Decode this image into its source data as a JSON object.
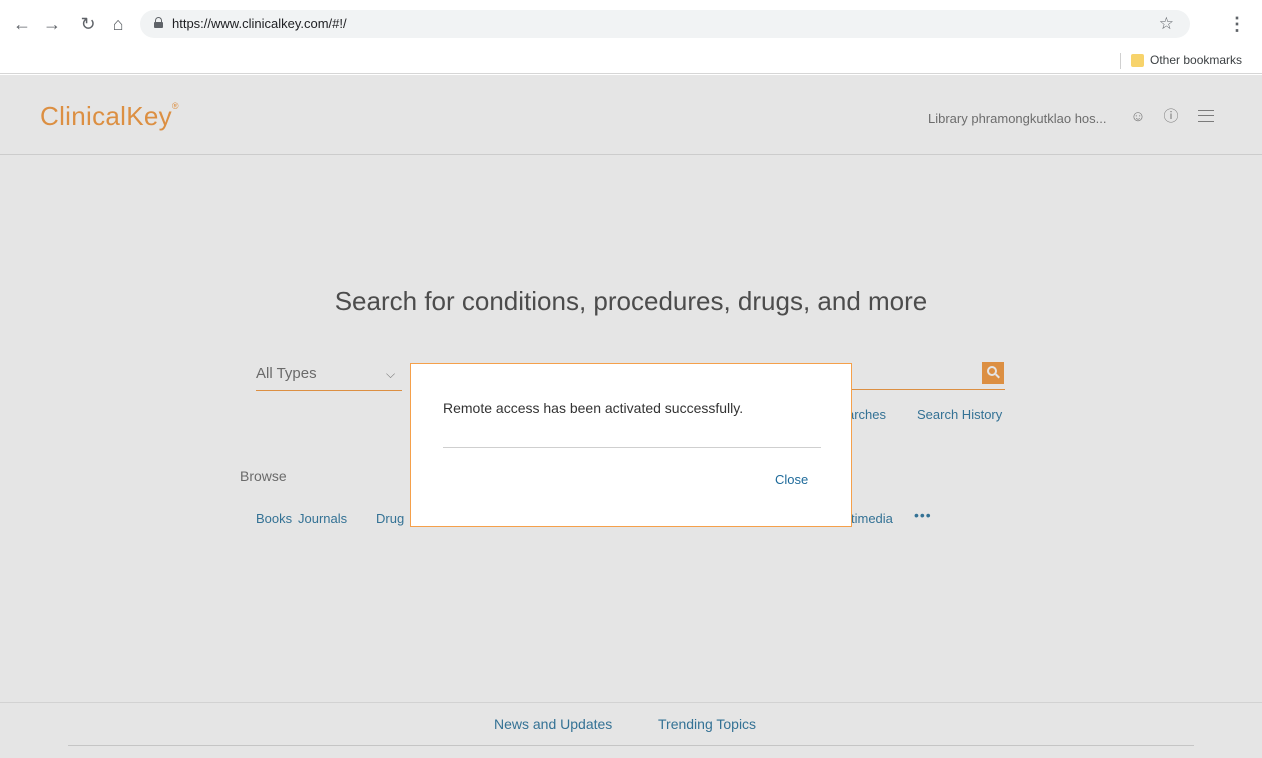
{
  "browser": {
    "url": "https://www.clinicalkey.com/#!/",
    "bookmarks_label": "Other bookmarks"
  },
  "header": {
    "logo": "ClinicalKey",
    "logo_mark": "®",
    "user_name": "Library phramongkutklao hos..."
  },
  "hero": {
    "title": "Search for conditions, procedures, drugs, and more"
  },
  "search": {
    "type_label": "All Types",
    "links": [
      "arches",
      "Search History"
    ]
  },
  "browse": {
    "label": "Browse",
    "links": [
      "Books",
      "Journals",
      "Drug",
      "timedia"
    ],
    "more": "•••"
  },
  "footer": {
    "links": [
      "News and Updates",
      "Trending Topics"
    ]
  },
  "modal": {
    "message": "Remote access has been activated successfully.",
    "close_label": "Close"
  },
  "colors": {
    "accent": "#f5a04a",
    "link": "#3a7fa6",
    "modal_border": "#f5a04a"
  }
}
